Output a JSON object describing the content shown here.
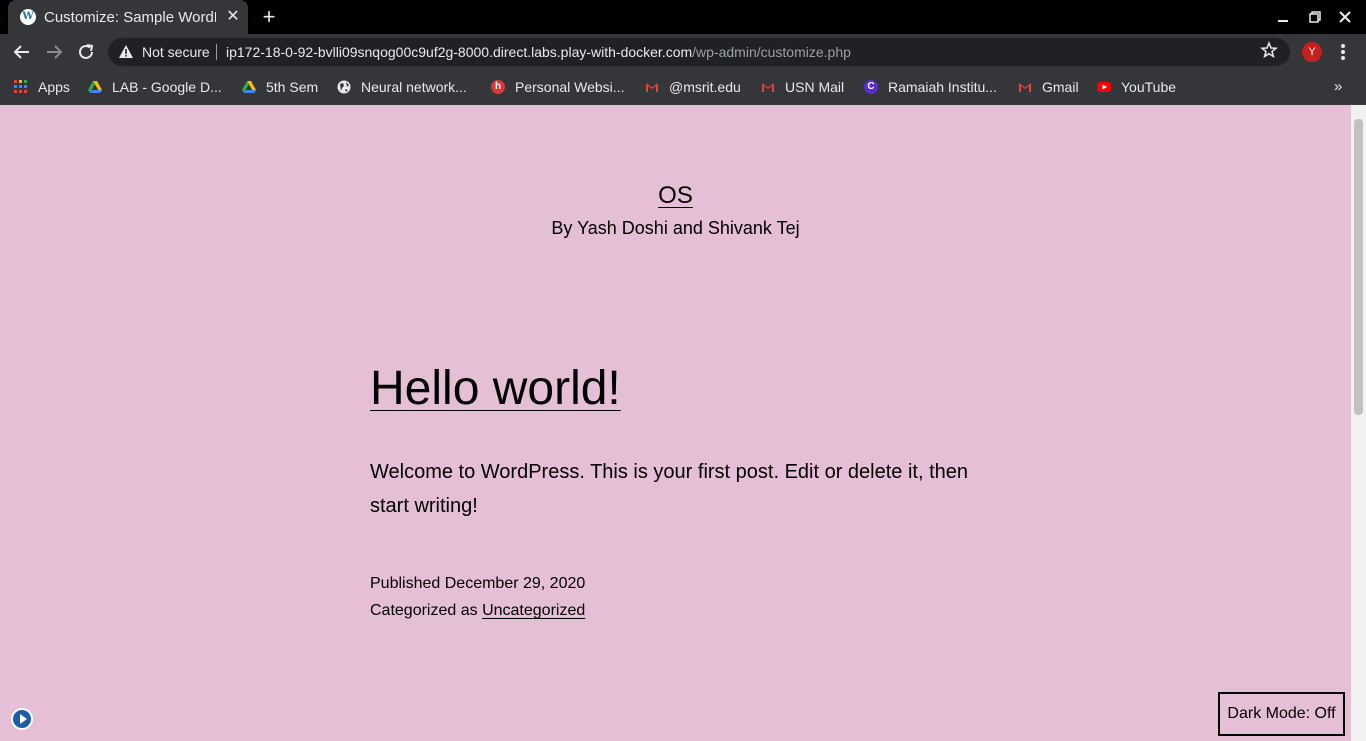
{
  "browser": {
    "tab_title": "Customize: Sample WordPress",
    "close_glyph": "✕",
    "new_tab_glyph": "+",
    "security_label": "Not secure",
    "url_host": "ip172-18-0-92-bvlli09snqog00c9uf2g-8000.direct.labs.play-with-docker.com",
    "url_path": "/wp-admin/customize.php",
    "profile_initial": "Y",
    "profile_color": "#c5221f"
  },
  "bookmarks": [
    {
      "label": "Apps",
      "icon": "apps-grid-icon"
    },
    {
      "label": "LAB - Google D...",
      "icon": "google-drive-icon"
    },
    {
      "label": "5th Sem",
      "icon": "google-drive-icon"
    },
    {
      "label": "Neural network...",
      "icon": "globe-icon"
    },
    {
      "label": "Personal Websi...",
      "icon": "h-logo-icon"
    },
    {
      "label": "@msrit.edu",
      "icon": "gmail-icon"
    },
    {
      "label": "USN Mail",
      "icon": "gmail-icon"
    },
    {
      "label": "Ramaiah Institu...",
      "icon": "c-logo-icon"
    },
    {
      "label": "Gmail",
      "icon": "gmail-icon"
    },
    {
      "label": "YouTube",
      "icon": "youtube-icon"
    }
  ],
  "site": {
    "title": "OS",
    "description": "By Yash Doshi and Shivank Tej",
    "background": "#e4bfd6"
  },
  "post": {
    "title": "Hello world!",
    "body": "Welcome to WordPress. This is your first post. Edit or delete it, then start writing!",
    "published_prefix": "Published",
    "published_date": "December 29, 2020",
    "category_prefix": "Categorized as",
    "category": "Uncategorized"
  },
  "dark_mode": {
    "label": "Dark Mode: Off"
  }
}
